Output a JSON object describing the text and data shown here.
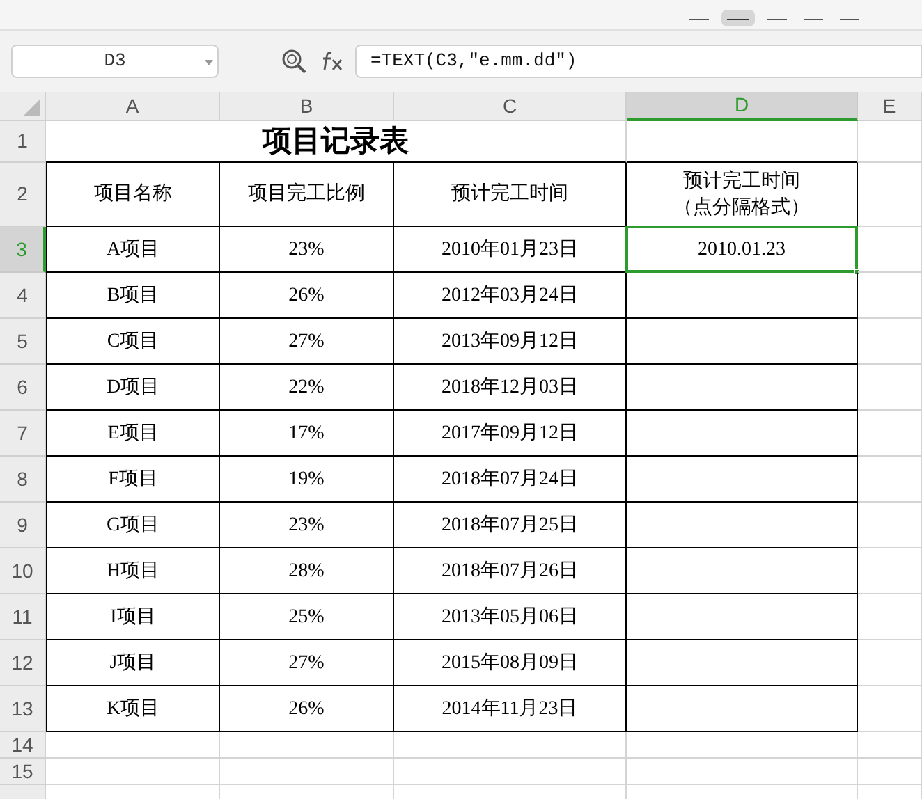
{
  "name_box": {
    "value": "D3"
  },
  "formula_bar": {
    "value": "=TEXT(C3,\"e.mm.dd\")"
  },
  "column_headers": [
    {
      "label": "A",
      "selected": false
    },
    {
      "label": "B",
      "selected": false
    },
    {
      "label": "C",
      "selected": false
    },
    {
      "label": "D",
      "selected": true
    },
    {
      "label": "E",
      "selected": false
    }
  ],
  "rows": [
    {
      "row_number": "1",
      "selected": false,
      "kind": "title",
      "title": "项目记录表"
    },
    {
      "row_number": "2",
      "selected": false,
      "kind": "header",
      "cells": [
        "项目名称",
        "项目完工比例",
        "预计完工时间",
        "预计完工时间（点分隔格式）"
      ]
    },
    {
      "row_number": "3",
      "selected": true,
      "kind": "data",
      "cells": [
        "A项目",
        "23%",
        "2010年01月23日",
        "2010.01.23"
      ]
    },
    {
      "row_number": "4",
      "selected": false,
      "kind": "data",
      "cells": [
        "B项目",
        "26%",
        "2012年03月24日"
      ]
    },
    {
      "row_number": "5",
      "selected": false,
      "kind": "data",
      "cells": [
        "C项目",
        "27%",
        "2013年09月12日"
      ]
    },
    {
      "row_number": "6",
      "selected": false,
      "kind": "data",
      "cells": [
        "D项目",
        "22%",
        "2018年12月03日"
      ]
    },
    {
      "row_number": "7",
      "selected": false,
      "kind": "data",
      "cells": [
        "E项目",
        "17%",
        "2017年09月12日"
      ]
    },
    {
      "row_number": "8",
      "selected": false,
      "kind": "data",
      "cells": [
        "F项目",
        "19%",
        "2018年07月24日"
      ]
    },
    {
      "row_number": "9",
      "selected": false,
      "kind": "data",
      "cells": [
        "G项目",
        "23%",
        "2018年07月25日"
      ]
    },
    {
      "row_number": "10",
      "selected": false,
      "kind": "data",
      "cells": [
        "H项目",
        "28%",
        "2018年07月26日"
      ]
    },
    {
      "row_number": "11",
      "selected": false,
      "kind": "data",
      "cells": [
        "I项目",
        "25%",
        "2013年05月06日"
      ]
    },
    {
      "row_number": "12",
      "selected": false,
      "kind": "data",
      "cells": [
        "J项目",
        "27%",
        "2015年08月09日"
      ]
    },
    {
      "row_number": "13",
      "selected": false,
      "kind": "data",
      "cells": [
        "K项目",
        "26%",
        "2014年11月23日"
      ]
    },
    {
      "row_number": "14",
      "selected": false,
      "kind": "empty"
    },
    {
      "row_number": "15",
      "selected": false,
      "kind": "empty"
    }
  ]
}
